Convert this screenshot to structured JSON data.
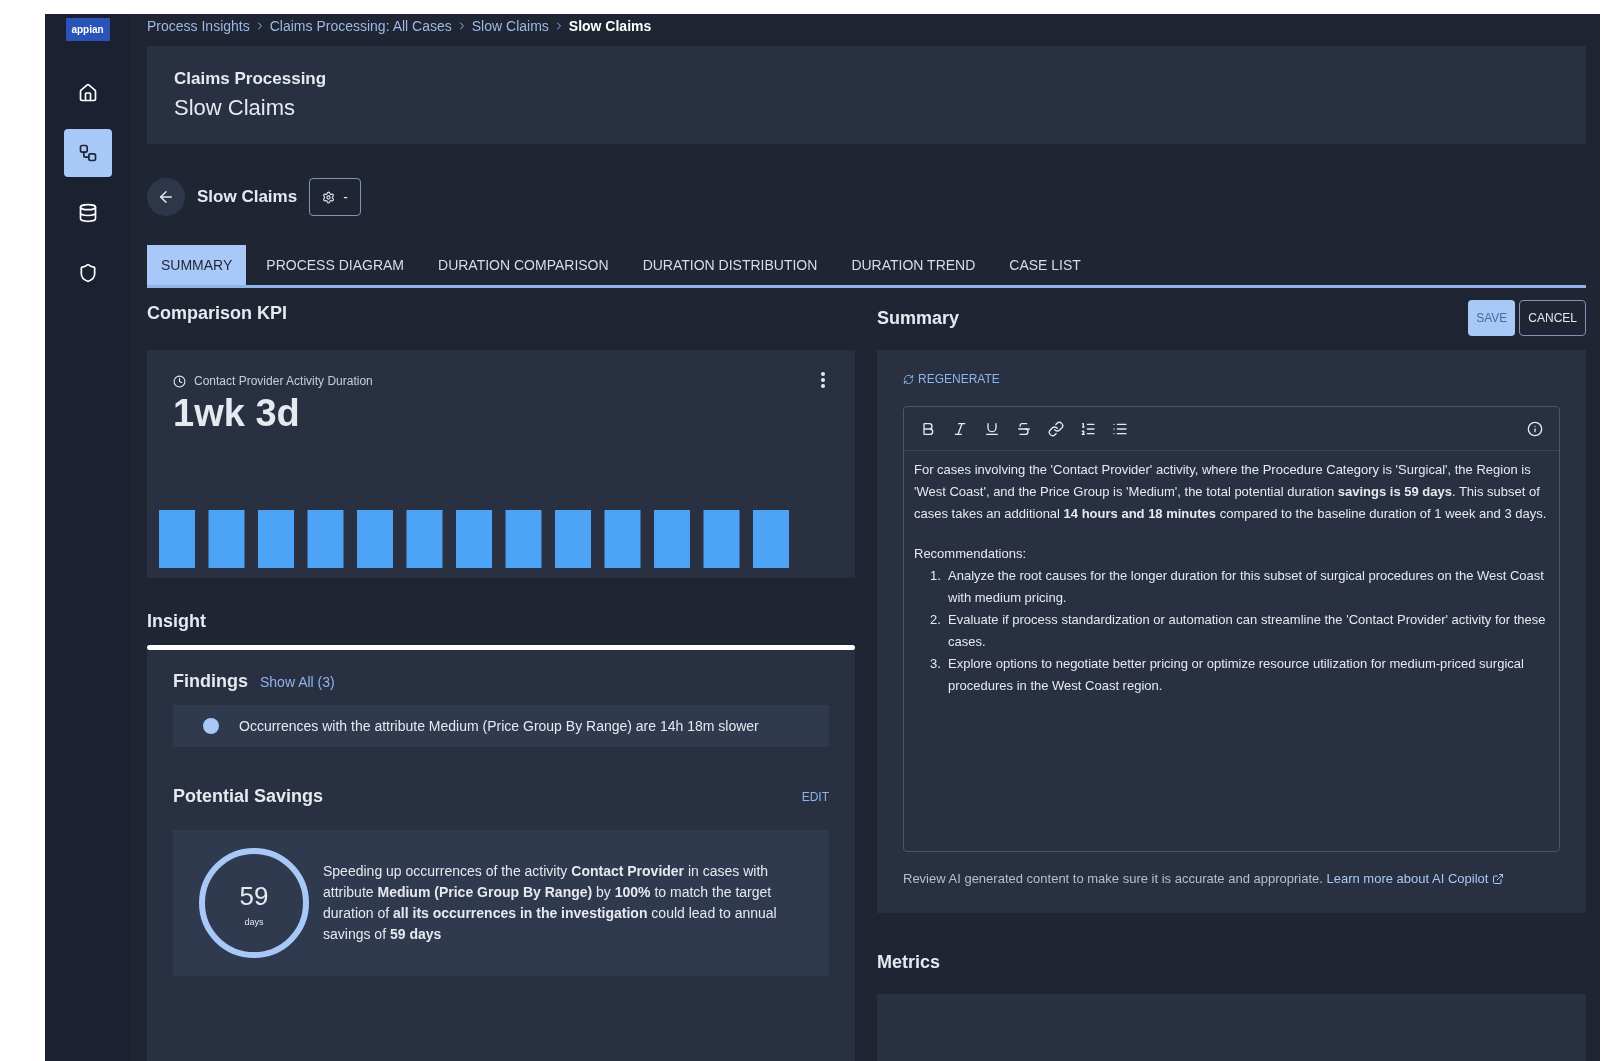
{
  "logo": "appian",
  "nav": [
    {
      "kind": "home",
      "selected": false
    },
    {
      "kind": "process",
      "selected": true
    },
    {
      "kind": "data",
      "selected": false
    },
    {
      "kind": "shield",
      "selected": false
    }
  ],
  "breadcrumb": [
    {
      "label": "Process Insights",
      "current": false
    },
    {
      "label": "Claims Processing: All Cases",
      "current": false
    },
    {
      "label": "Slow Claims",
      "current": false
    },
    {
      "label": "Slow Claims",
      "current": true
    }
  ],
  "header": {
    "subtitle": "Claims Processing",
    "title": "Slow Claims"
  },
  "investigation": {
    "title": "Slow Claims",
    "filter_label": "-"
  },
  "tabs": [
    {
      "label": "SUMMARY",
      "selected": true
    },
    {
      "label": "PROCESS DIAGRAM",
      "selected": false
    },
    {
      "label": "DURATION COMPARISON",
      "selected": false
    },
    {
      "label": "DURATION DISTRIBUTION",
      "selected": false
    },
    {
      "label": "DURATION TREND",
      "selected": false
    },
    {
      "label": "CASE LIST",
      "selected": false
    }
  ],
  "kpi": {
    "heading": "Comparison KPI",
    "label": "Contact Provider Activity Duration",
    "value": "1wk 3d"
  },
  "insight": {
    "heading": "Insight",
    "findings_title": "Findings",
    "show_all": "Show All (3)",
    "findings": [
      {
        "text": "Occurrences with the attribute Medium (Price Group By Range) are 14h 18m slower",
        "color": "#a8c8f8"
      }
    ],
    "savings_title": "Potential Savings",
    "edit": "EDIT",
    "savings_value": "59",
    "savings_unit": "days",
    "savings_text": "Speeding up occurrences of the activity **Contact Provider** in cases with attribute **Medium (Price Group By Range)** by **100%** to match the target duration of **all its occurrences in the investigation** could lead to annual savings of **59 days**"
  },
  "summary": {
    "heading": "Summary",
    "save": "SAVE",
    "cancel": "CANCEL",
    "regenerate": "REGENERATE",
    "paragraph": "For cases involving the 'Contact Provider' activity, where the Procedure Category is 'Surgical', the Region is 'West Coast', and the Price Group is 'Medium', the total potential duration **savings is 59 days**. This subset of cases takes an additional **14 hours and 18 minutes** compared to the baseline duration of 1 week and 3 days.",
    "recommendations_label": "Recommendations:",
    "recommendations": [
      {
        "number": "1.",
        "text": "Analyze the root causes for the longer duration for this subset of surgical procedures on the West Coast with medium pricing."
      },
      {
        "number": "2.",
        "text": "Evaluate if process standardization or automation can streamline the 'Contact Provider' activity for these cases."
      },
      {
        "number": "3.",
        "text": "Explore options to negotiate better pricing or optimize resource utilization for medium-priced surgical procedures in the West Coast region."
      }
    ],
    "disclaimer": "Review AI generated content to make sure it is accurate and appropriate.",
    "learn_more": "Learn more about AI Copilot"
  },
  "metrics": {
    "heading": "Metrics"
  }
}
